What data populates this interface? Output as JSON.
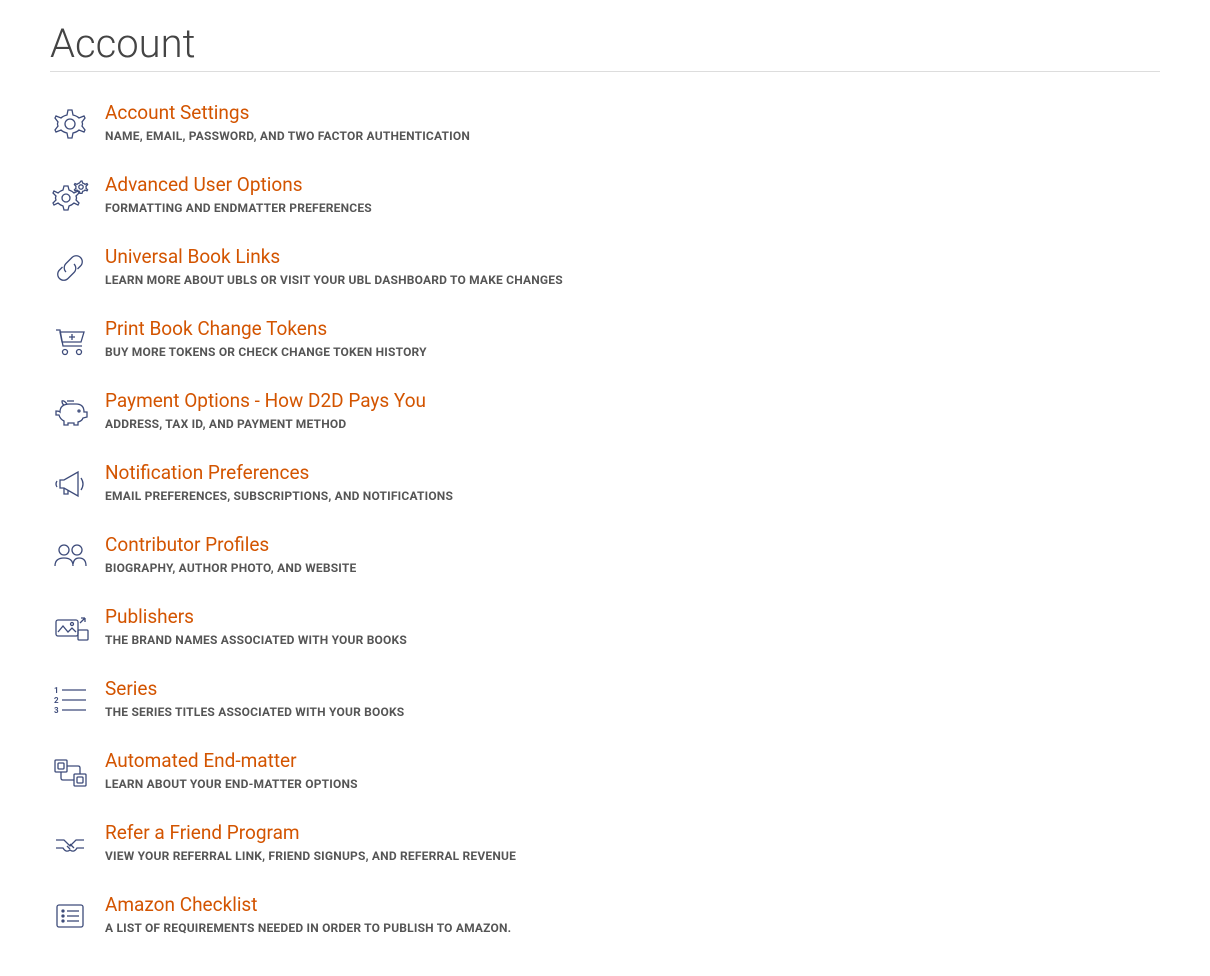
{
  "page_title": "Account",
  "items": [
    {
      "title": "Account Settings",
      "desc": "NAME, EMAIL, PASSWORD, AND TWO FACTOR AUTHENTICATION",
      "icon": "gear-icon",
      "name": "account-settings-link"
    },
    {
      "title": "Advanced User Options",
      "desc": "FORMATTING AND ENDMATTER PREFERENCES",
      "icon": "gears-icon",
      "name": "advanced-user-options-link"
    },
    {
      "title": "Universal Book Links",
      "desc": "LEARN MORE ABOUT UBLS OR VISIT YOUR UBL DASHBOARD TO MAKE CHANGES",
      "icon": "link-icon",
      "name": "universal-book-links-link"
    },
    {
      "title": "Print Book Change Tokens",
      "desc": "BUY MORE TOKENS OR CHECK CHANGE TOKEN HISTORY",
      "icon": "cart-icon",
      "name": "print-book-change-tokens-link"
    },
    {
      "title": "Payment Options - How D2D Pays You",
      "desc": "ADDRESS, TAX ID, AND PAYMENT METHOD",
      "icon": "piggy-bank-icon",
      "name": "payment-options-link"
    },
    {
      "title": "Notification Preferences",
      "desc": "EMAIL PREFERENCES, SUBSCRIPTIONS, AND NOTIFICATIONS",
      "icon": "megaphone-icon",
      "name": "notification-preferences-link"
    },
    {
      "title": "Contributor Profiles",
      "desc": "BIOGRAPHY, AUTHOR PHOTO, AND WEBSITE",
      "icon": "people-icon",
      "name": "contributor-profiles-link"
    },
    {
      "title": "Publishers",
      "desc": "THE BRAND NAMES ASSOCIATED WITH YOUR BOOKS",
      "icon": "picture-arrow-icon",
      "name": "publishers-link"
    },
    {
      "title": "Series",
      "desc": "THE SERIES TITLES ASSOCIATED WITH YOUR BOOKS",
      "icon": "numbered-list-icon",
      "name": "series-link"
    },
    {
      "title": "Automated End-matter",
      "desc": "LEARN ABOUT YOUR END-MATTER OPTIONS",
      "icon": "flow-nodes-icon",
      "name": "automated-end-matter-link"
    },
    {
      "title": "Refer a Friend Program",
      "desc": "VIEW YOUR REFERRAL LINK, FRIEND SIGNUPS, AND REFERRAL REVENUE",
      "icon": "handshake-icon",
      "name": "refer-a-friend-link"
    },
    {
      "title": "Amazon Checklist",
      "desc": "A LIST OF REQUIREMENTS NEEDED IN ORDER TO PUBLISH TO AMAZON.",
      "icon": "checklist-icon",
      "name": "amazon-checklist-link"
    }
  ]
}
